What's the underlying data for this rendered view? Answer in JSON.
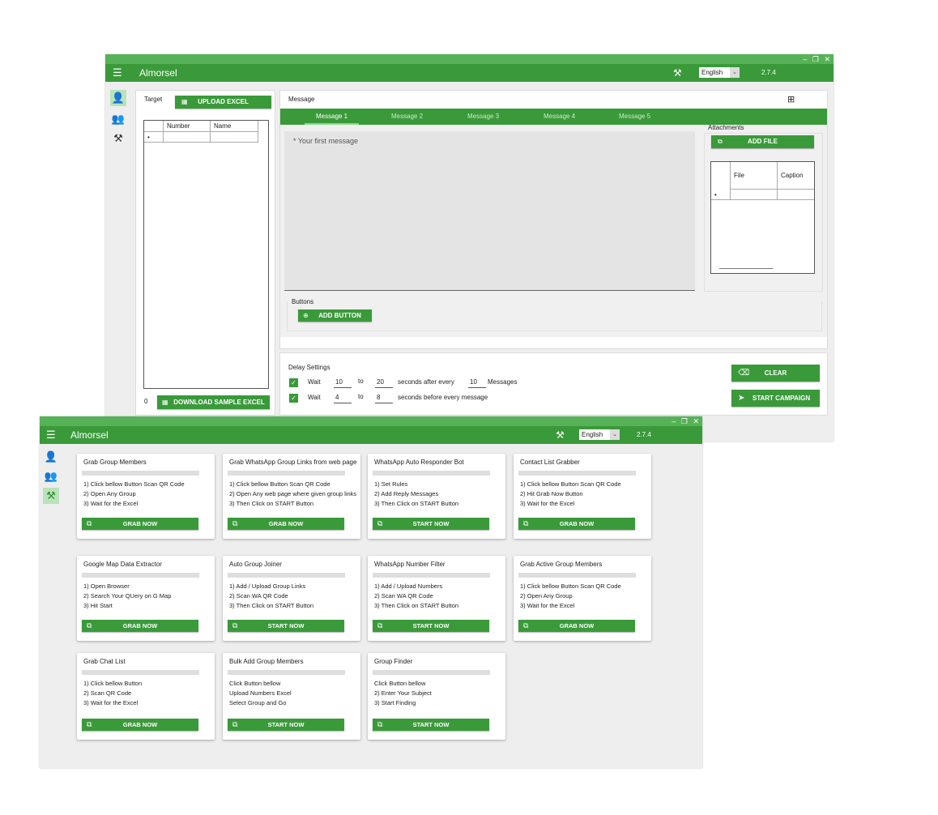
{
  "window1": {
    "title": "Almorsel",
    "language": "English",
    "version": "2.7.4",
    "window_controls": [
      "–",
      "❐",
      "✕"
    ],
    "sidebar_icons": [
      "user-icon",
      "group-icon",
      "tools-icon"
    ],
    "target": {
      "label": "Target",
      "upload_label": "UPLOAD EXCEL",
      "columns": [
        "Number",
        "Name"
      ],
      "row_marker": "•",
      "count": "0",
      "download_label": "DOWNLOAD SAMPLE EXCEL"
    },
    "message": {
      "label": "Message",
      "add_icon": "⊞",
      "tabs": [
        "Message 1",
        "Message 2",
        "Message 3",
        "Message 4",
        "Message 5"
      ],
      "placeholder": "* Your first message",
      "attachments_label": "Attachments",
      "add_file_label": "ADD FILE",
      "attach_columns": [
        "File",
        "Caption"
      ],
      "row_marker": "•",
      "buttons_label": "Buttons",
      "add_button_label": "ADD BUTTON"
    },
    "delay": {
      "label": "Delay Settings",
      "row1": {
        "wait": "Wait",
        "from": "10",
        "to_word": "to",
        "to": "20",
        "text": "seconds after every",
        "count": "10",
        "unit": "Messages"
      },
      "row2": {
        "wait": "Wait",
        "from": "4",
        "to_word": "to",
        "to": "8",
        "text": "seconds before every message"
      },
      "clear_label": "CLEAR",
      "start_label": "START CAMPAIGN"
    }
  },
  "window2": {
    "title": "Almorsel",
    "language": "English",
    "version": "2.7.4",
    "window_controls": [
      "–",
      "❐",
      "✕"
    ],
    "cards": [
      {
        "title": "Grab Group Members",
        "lines": [
          "1) Click bellow Button Scan QR Code",
          "2) Open Any Group",
          "3) Wait for the Excel"
        ],
        "button": "GRAB NOW"
      },
      {
        "title": "Grab WhatsApp Group Links from web page",
        "lines": [
          "1) Click bellow Button Scan QR Code",
          "2) Open Any web page where given group links",
          "3) Then Click on START Button"
        ],
        "button": "GRAB NOW"
      },
      {
        "title": "WhatsApp Auto Responder Bot",
        "lines": [
          "1) Set Rules",
          "2) Add Reply Messages",
          "3) Then Click on START Button"
        ],
        "button": "START NOW"
      },
      {
        "title": "Contact List Grabber",
        "lines": [
          "1) Click bellow Button Scan QR Code",
          "2) Hit Grab Now Button",
          "3) Wait for the Excel"
        ],
        "button": "GRAB NOW"
      },
      {
        "title": "Google Map Data Extractor",
        "lines": [
          "1) Open Browser",
          "2) Search Your QUery on G Map",
          "3) Hit Start"
        ],
        "button": "GRAB NOW"
      },
      {
        "title": "Auto Group Joiner",
        "lines": [
          "1) Add / Upload Group Links",
          "2) Scan WA QR Code",
          "3) Then Click on START Button"
        ],
        "button": "START NOW"
      },
      {
        "title": "WhatsApp Number Filter",
        "lines": [
          "1) Add / Upload Numbers",
          "2) Scan WA QR Code",
          "3) Then Click on START Button"
        ],
        "button": "START NOW"
      },
      {
        "title": "Grab Active Group Members",
        "lines": [
          "1) Click bellow Button Scan QR Code",
          "2) Open Any Group",
          "3) Wait for the Excel"
        ],
        "button": "GRAB NOW"
      },
      {
        "title": "Grab Chat List",
        "lines": [
          "1) Click bellow Button",
          "2) Scan QR Code",
          "3) Wait for the Excel"
        ],
        "button": "GRAB NOW"
      },
      {
        "title": "Bulk Add Group Members",
        "lines": [
          "Click Button bellow",
          "Upload Numbers Excel",
          "Select Group and Go"
        ],
        "button": "START NOW"
      },
      {
        "title": "Group Finder",
        "lines": [
          "Click Button bellow",
          "2) Enter Your Subject",
          "3) Start Finding"
        ],
        "button": "START NOW"
      }
    ]
  },
  "colors": {
    "primary": "#3a9a3a",
    "light": "#56b256",
    "active_sidebar": "#b9e3b9"
  }
}
